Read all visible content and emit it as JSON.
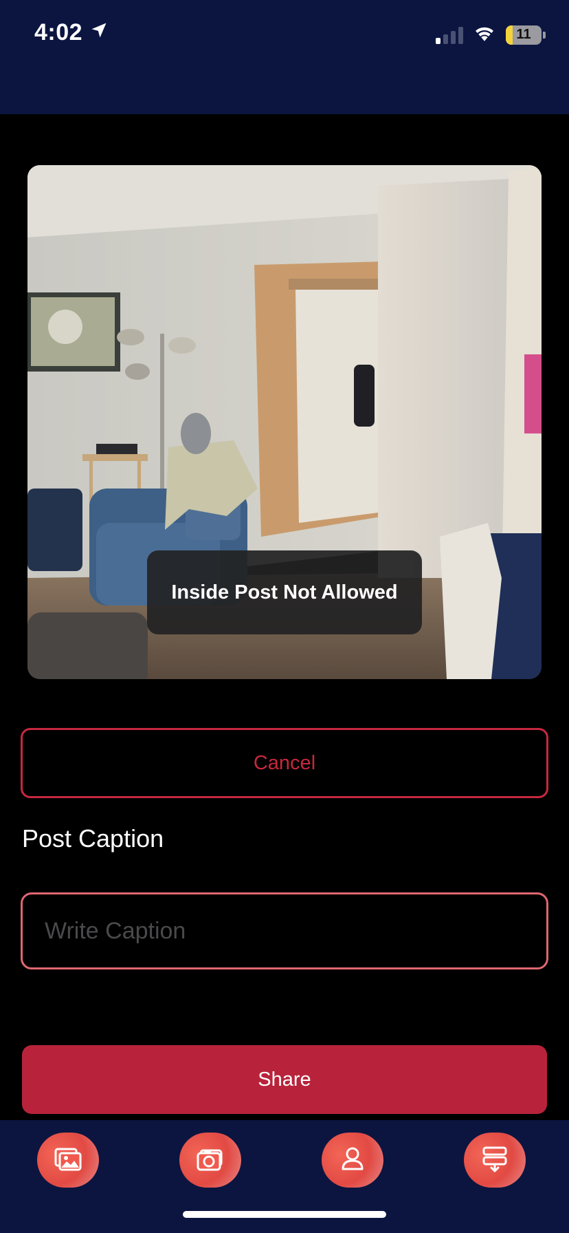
{
  "status_bar": {
    "time": "4:02",
    "battery": "11",
    "icons": [
      "location-arrow-icon",
      "cellular-signal-icon",
      "wifi-icon",
      "battery-icon"
    ]
  },
  "toast": {
    "message": "Inside Post Not Allowed"
  },
  "cancel": {
    "label": "Cancel"
  },
  "caption": {
    "label": "Post Caption",
    "placeholder": "Write Caption",
    "value": ""
  },
  "share": {
    "label": "Share"
  },
  "tabs": [
    {
      "name": "gallery",
      "icon": "gallery-icon"
    },
    {
      "name": "camera",
      "icon": "camera-icon"
    },
    {
      "name": "profile",
      "icon": "profile-icon"
    },
    {
      "name": "feed",
      "icon": "feed-download-icon"
    }
  ],
  "colors": {
    "navy": "#0b1540",
    "accent_red": "#b8233b",
    "outline_red": "#c7283f",
    "input_border": "#e0676f"
  }
}
